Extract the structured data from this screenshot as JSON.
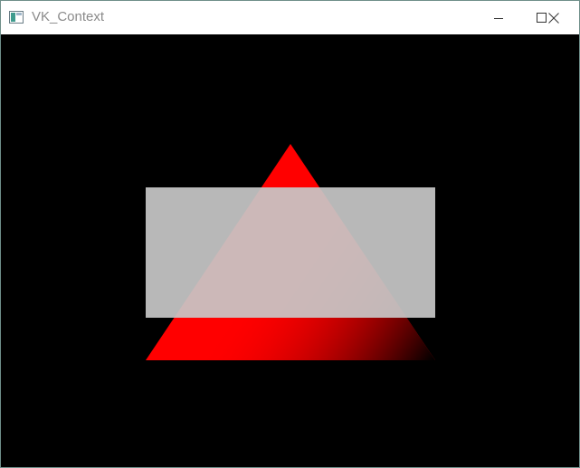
{
  "window": {
    "title": "VK_Context",
    "controls": {
      "minimize_icon": "minimize-icon",
      "maximize_icon": "maximize-icon",
      "close_icon": "close-icon"
    }
  },
  "viewport": {
    "clear_color": "#000000",
    "triangle": {
      "vertex_colors": {
        "top": "#ff0000",
        "bottom_left": "#ff0000",
        "bottom_right": "#000000"
      }
    },
    "rectangle": {
      "color": "#c8c8c8",
      "opacity": 0.92
    }
  }
}
